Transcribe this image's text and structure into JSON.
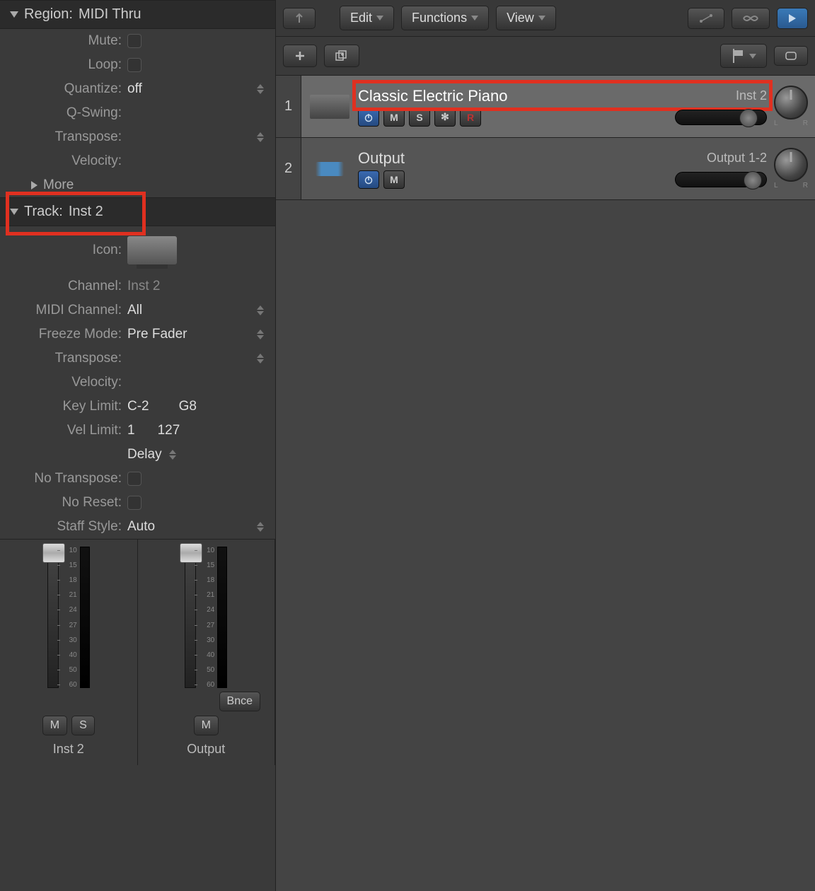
{
  "region": {
    "header_label": "Region:",
    "header_value": "MIDI Thru",
    "mute_label": "Mute:",
    "loop_label": "Loop:",
    "quantize_label": "Quantize:",
    "quantize_value": "off",
    "qswing_label": "Q-Swing:",
    "transpose_label": "Transpose:",
    "velocity_label": "Velocity:",
    "more_label": "More"
  },
  "track": {
    "header_label": "Track:",
    "header_value": "Inst 2",
    "icon_label": "Icon:",
    "channel_label": "Channel:",
    "channel_value": "Inst 2",
    "midi_label": "MIDI Channel:",
    "midi_value": "All",
    "freeze_label": "Freeze Mode:",
    "freeze_value": "Pre Fader",
    "transpose_label": "Transpose:",
    "velocity_label": "Velocity:",
    "keylimit_label": "Key Limit:",
    "keylimit_low": "C-2",
    "keylimit_high": "G8",
    "vellimit_label": "Vel Limit:",
    "vellimit_low": "1",
    "vellimit_high": "127",
    "delay_label": "Delay",
    "notranspose_label": "No Transpose:",
    "noreset_label": "No Reset:",
    "staff_label": "Staff Style:",
    "staff_value": "Auto"
  },
  "mixer": {
    "bnce_label": "Bnce",
    "m_label": "M",
    "s_label": "S",
    "strip1_name": "Inst 2",
    "strip2_name": "Output",
    "scale_values": [
      "10",
      "15",
      "18",
      "21",
      "24",
      "27",
      "30",
      "40",
      "50",
      "60"
    ]
  },
  "toolbar": {
    "edit": "Edit",
    "functions": "Functions",
    "view": "View"
  },
  "tracks": [
    {
      "num": "1",
      "name": "Classic Electric Piano",
      "id": "Inst 2"
    },
    {
      "num": "2",
      "name": "Output",
      "id": "Output 1-2"
    }
  ],
  "buttons": {
    "m": "M",
    "s": "S",
    "r": "R",
    "freeze_icon": "✻"
  }
}
